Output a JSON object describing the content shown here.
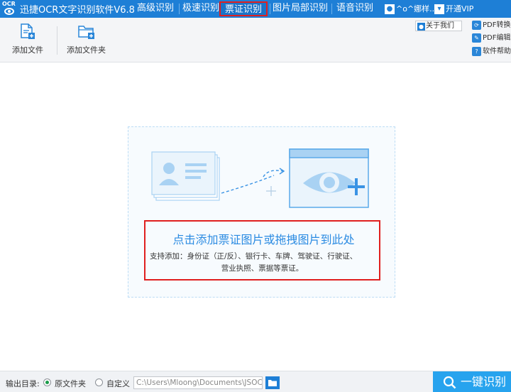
{
  "titlebar": {
    "logo_text": "OCR",
    "app_title": "迅捷OCR文字识别软件V6.8",
    "tabs": [
      {
        "label": "高级识别",
        "active": false
      },
      {
        "label": "极速识别",
        "active": false
      },
      {
        "label": "票证识别",
        "active": true
      },
      {
        "label": "图片局部识别",
        "active": false
      },
      {
        "label": "语音识别",
        "active": false
      }
    ],
    "user_name": "^o^娜样...",
    "vip_label": "开通VIP"
  },
  "toolbar": {
    "add_file_label": "添加文件",
    "add_folder_label": "添加文件夹",
    "about_label": "关于我们",
    "pdf_convert_label": "PDF转换",
    "pdf_edit_label": "PDF编辑",
    "help_label": "软件帮助"
  },
  "drop_zone": {
    "hint_main": "点击添加票证图片或拖拽图片到此处",
    "hint_sub_line1": "支持添加：身份证（正/反）、银行卡、车牌、驾驶证、行驶证、",
    "hint_sub_line2": "营业执照、票据等票证。"
  },
  "bottombar": {
    "output_label": "输出目录:",
    "option_original": "原文件夹",
    "option_custom": "自定义",
    "path_value": "C:\\Users\\Mloong\\Documents\\JSOC",
    "selected_option": "原文件夹",
    "recognize_label": "一键识别"
  },
  "colors": {
    "brand_blue": "#1e7fd6",
    "highlight_red": "#e01f1f",
    "hint_blue": "#2b8be2",
    "button_blue": "#27a3ee"
  }
}
